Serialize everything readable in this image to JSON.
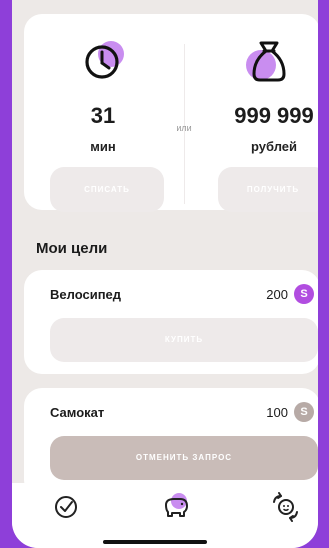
{
  "exchange": {
    "time_value": "31",
    "time_unit": "мин",
    "or_label": "или",
    "money_value": "999 999",
    "money_unit": "рублей",
    "spend_button": "СПИСАТЬ",
    "receive_button": "ПОЛУЧИТЬ"
  },
  "goals_section": {
    "title": "Мои цели",
    "items": [
      {
        "name": "Велосипед",
        "price": "200",
        "coin_symbol": "S",
        "action": "КУПИТЬ",
        "state": "available"
      },
      {
        "name": "Самокат",
        "price": "100",
        "coin_symbol": "S",
        "action": "ОТМЕНИТЬ ЗАПРОС",
        "state": "requested"
      }
    ]
  },
  "bottom_nav": {
    "tabs": [
      {
        "icon": "clock-check-icon",
        "active": false
      },
      {
        "icon": "piggy-bank-icon",
        "active": true
      },
      {
        "icon": "child-swap-icon",
        "active": false
      }
    ]
  },
  "colors": {
    "accent": "#b14de0",
    "frame": "#8e3fd9",
    "background": "#ede9e7",
    "muted_coin": "#b7aaa6"
  }
}
